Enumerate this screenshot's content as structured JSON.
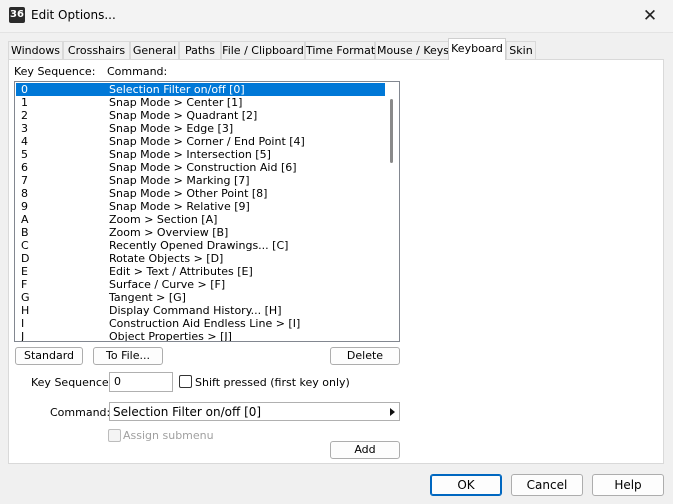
{
  "window": {
    "title": "Edit Options...",
    "icon_text": "36"
  },
  "tabs": [
    {
      "label": "Windows"
    },
    {
      "label": "Crosshairs"
    },
    {
      "label": "General"
    },
    {
      "label": "Paths"
    },
    {
      "label": "File / Clipboard"
    },
    {
      "label": "Time Format"
    },
    {
      "label": "Mouse / Keys"
    },
    {
      "label": "Keyboard",
      "active": true
    },
    {
      "label": "Skin"
    }
  ],
  "list": {
    "header_key": "Key Sequence:",
    "header_command": "Command:",
    "items": [
      {
        "key": "0",
        "command": "Selection Filter on/off [0]",
        "selected": true
      },
      {
        "key": "1",
        "command": "Snap Mode > Center [1]"
      },
      {
        "key": "2",
        "command": "Snap Mode > Quadrant [2]"
      },
      {
        "key": "3",
        "command": "Snap Mode > Edge [3]"
      },
      {
        "key": "4",
        "command": "Snap Mode > Corner / End Point [4]"
      },
      {
        "key": "5",
        "command": "Snap Mode > Intersection [5]"
      },
      {
        "key": "6",
        "command": "Snap Mode > Construction Aid [6]"
      },
      {
        "key": "7",
        "command": "Snap Mode > Marking [7]"
      },
      {
        "key": "8",
        "command": "Snap Mode > Other Point [8]"
      },
      {
        "key": "9",
        "command": "Snap Mode > Relative [9]"
      },
      {
        "key": "A",
        "command": "Zoom > Section [A]"
      },
      {
        "key": "B",
        "command": "Zoom > Overview [B]"
      },
      {
        "key": "C",
        "command": "Recently Opened Drawings... [C]"
      },
      {
        "key": "D",
        "command": "Rotate Objects > [D]"
      },
      {
        "key": "E",
        "command": "Edit > Text / Attributes [E]"
      },
      {
        "key": "F",
        "command": "Surface / Curve > [F]"
      },
      {
        "key": "G",
        "command": "Tangent > [G]"
      },
      {
        "key": "H",
        "command": "Display Command History... [H]"
      },
      {
        "key": "I",
        "command": "Construction Aid Endless Line > [I]"
      },
      {
        "key": "J",
        "command": "Object Properties > [J]"
      }
    ]
  },
  "buttons": {
    "standard": "Standard",
    "to_file": "To File...",
    "delete": "Delete",
    "add": "Add",
    "ok": "OK",
    "cancel": "Cancel",
    "help": "Help"
  },
  "form": {
    "key_sequence_label": "Key Sequence:",
    "key_sequence_value": "0",
    "shift_label": "Shift pressed (first key only)",
    "command_label": "Command:",
    "command_value": "Selection Filter on/off [0]",
    "assign_submenu_label": "Assign submenu"
  },
  "colors": {
    "selection": "#0078d7",
    "accent": "#0067c0"
  }
}
